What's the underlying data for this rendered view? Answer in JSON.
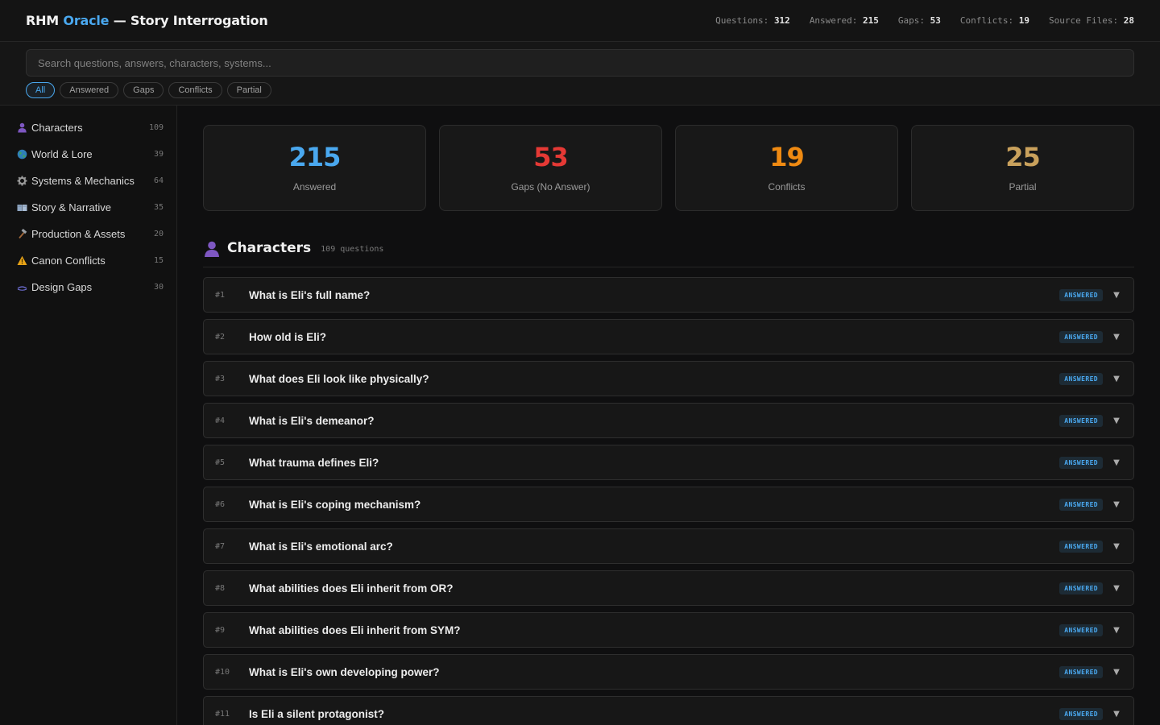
{
  "header": {
    "brand_prefix": "RHM",
    "brand_accent": "Oracle",
    "brand_suffix": "— Story Interrogation",
    "stats": [
      {
        "label": "Questions:",
        "value": "312"
      },
      {
        "label": "Answered:",
        "value": "215"
      },
      {
        "label": "Gaps:",
        "value": "53"
      },
      {
        "label": "Conflicts:",
        "value": "19"
      },
      {
        "label": "Source Files:",
        "value": "28"
      }
    ]
  },
  "search": {
    "placeholder": "Search questions, answers, characters, systems...",
    "value": ""
  },
  "filters": [
    {
      "label": "All",
      "active": true
    },
    {
      "label": "Answered",
      "active": false
    },
    {
      "label": "Gaps",
      "active": false
    },
    {
      "label": "Conflicts",
      "active": false
    },
    {
      "label": "Partial",
      "active": false
    }
  ],
  "sidebar": {
    "items": [
      {
        "label": "Characters",
        "count": "109",
        "icon": "person-icon"
      },
      {
        "label": "World & Lore",
        "count": "39",
        "icon": "globe-icon"
      },
      {
        "label": "Systems & Mechanics",
        "count": "64",
        "icon": "gear-icon"
      },
      {
        "label": "Story & Narrative",
        "count": "35",
        "icon": "book-icon"
      },
      {
        "label": "Production & Assets",
        "count": "20",
        "icon": "hammer-icon"
      },
      {
        "label": "Canon Conflicts",
        "count": "15",
        "icon": "warning-icon"
      },
      {
        "label": "Design Gaps",
        "count": "30",
        "icon": "link-icon"
      }
    ]
  },
  "summary": [
    {
      "value": "215",
      "label": "Answered",
      "color": "#4aa8ef"
    },
    {
      "value": "53",
      "label": "Gaps (No Answer)",
      "color": "#e53935"
    },
    {
      "value": "19",
      "label": "Conflicts",
      "color": "#ef8a12"
    },
    {
      "value": "25",
      "label": "Partial",
      "color": "#c9a15c"
    }
  ],
  "section": {
    "title": "Characters",
    "count_text": "109 questions",
    "icon": "person-icon"
  },
  "questions": [
    {
      "num": "#1",
      "text": "What is Eli's full name?",
      "status": "ANSWERED"
    },
    {
      "num": "#2",
      "text": "How old is Eli?",
      "status": "ANSWERED"
    },
    {
      "num": "#3",
      "text": "What does Eli look like physically?",
      "status": "ANSWERED"
    },
    {
      "num": "#4",
      "text": "What is Eli's demeanor?",
      "status": "ANSWERED"
    },
    {
      "num": "#5",
      "text": "What trauma defines Eli?",
      "status": "ANSWERED"
    },
    {
      "num": "#6",
      "text": "What is Eli's coping mechanism?",
      "status": "ANSWERED"
    },
    {
      "num": "#7",
      "text": "What is Eli's emotional arc?",
      "status": "ANSWERED"
    },
    {
      "num": "#8",
      "text": "What abilities does Eli inherit from OR?",
      "status": "ANSWERED"
    },
    {
      "num": "#9",
      "text": "What abilities does Eli inherit from SYM?",
      "status": "ANSWERED"
    },
    {
      "num": "#10",
      "text": "What is Eli's own developing power?",
      "status": "ANSWERED"
    },
    {
      "num": "#11",
      "text": "Is Eli a silent protagonist?",
      "status": "ANSWERED"
    }
  ],
  "colors": {
    "accent": "#4aa8ef",
    "background": "#0f0f10"
  }
}
